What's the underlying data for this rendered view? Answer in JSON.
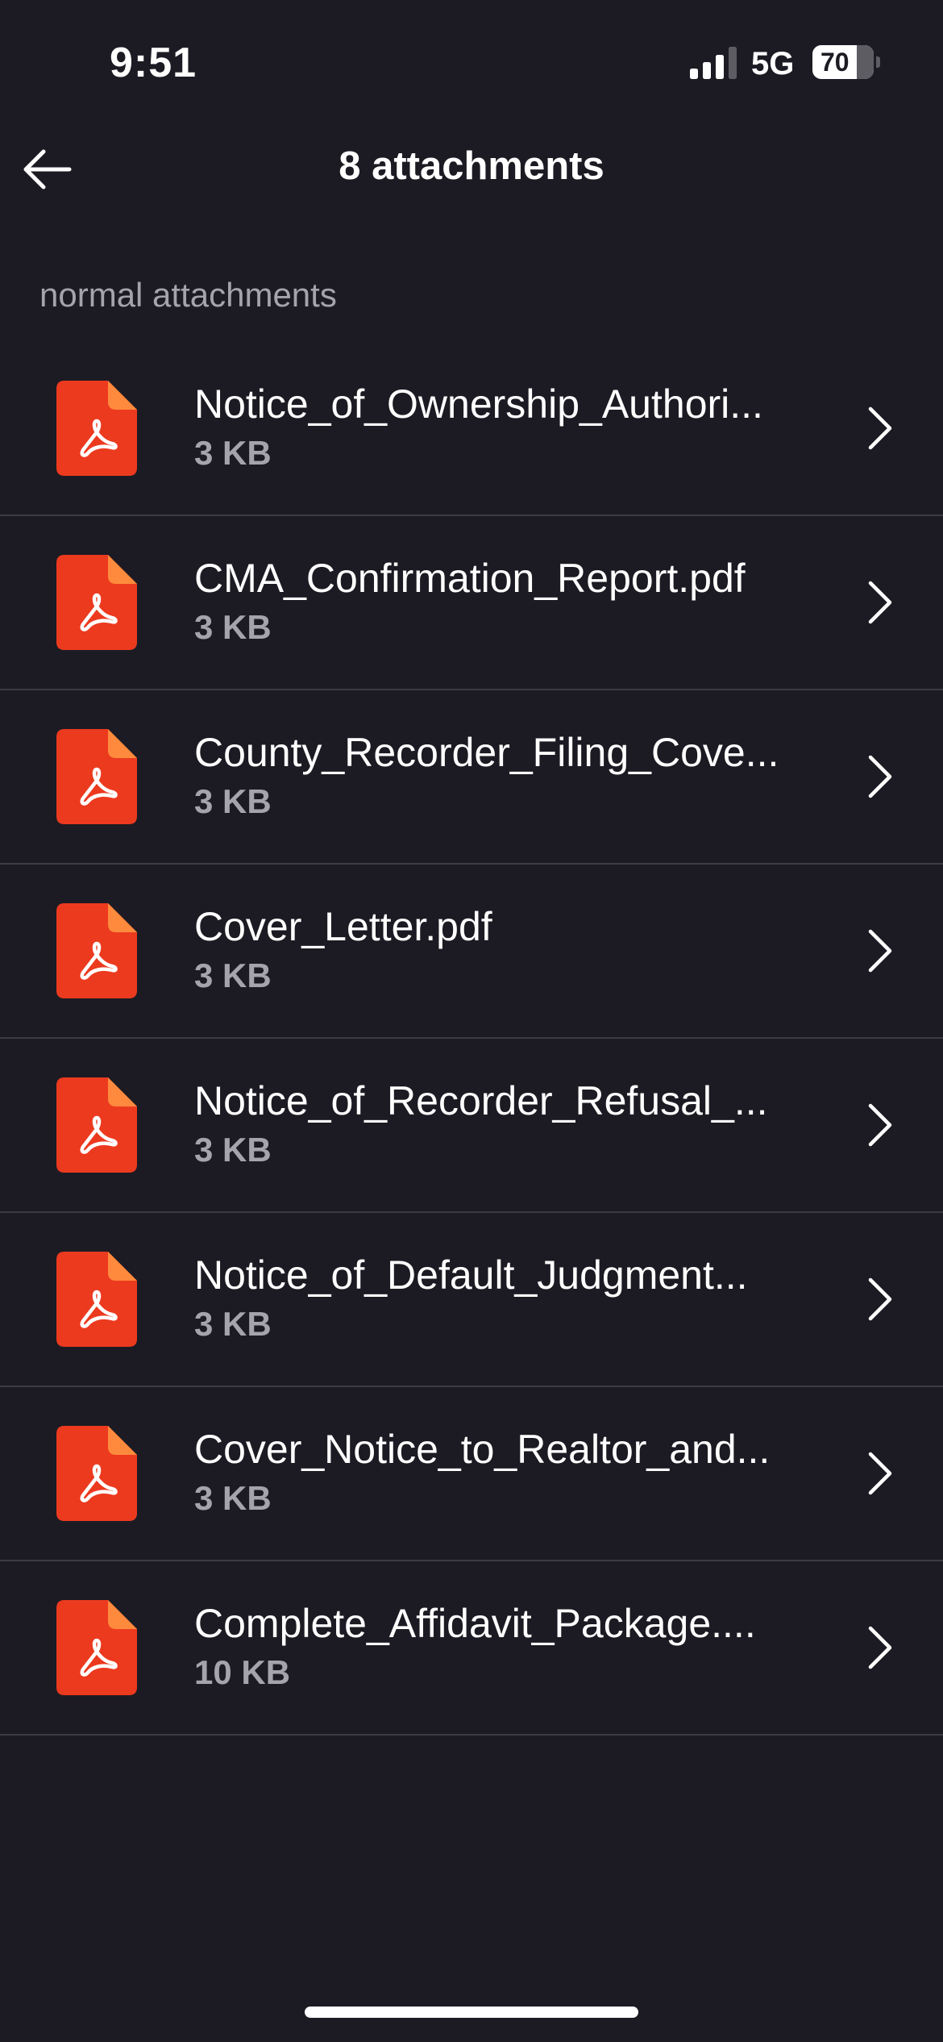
{
  "status_bar": {
    "time": "9:51",
    "network": "5G",
    "battery": "70"
  },
  "header": {
    "title": "8 attachments"
  },
  "section": {
    "label": "normal attachments"
  },
  "attachments": [
    {
      "name": "Notice_of_Ownership_Authori...",
      "size": "3 KB",
      "icon": "pdf-icon"
    },
    {
      "name": "CMA_Confirmation_Report.pdf",
      "size": "3 KB",
      "icon": "pdf-icon"
    },
    {
      "name": "County_Recorder_Filing_Cove...",
      "size": "3 KB",
      "icon": "pdf-icon"
    },
    {
      "name": "Cover_Letter.pdf",
      "size": "3 KB",
      "icon": "pdf-icon"
    },
    {
      "name": "Notice_of_Recorder_Refusal_...",
      "size": "3 KB",
      "icon": "pdf-icon"
    },
    {
      "name": "Notice_of_Default_Judgment...",
      "size": "3 KB",
      "icon": "pdf-icon"
    },
    {
      "name": "Cover_Notice_to_Realtor_and...",
      "size": "3 KB",
      "icon": "pdf-icon"
    },
    {
      "name": "Complete_Affidavit_Package....",
      "size": "10 KB",
      "icon": "pdf-icon"
    }
  ],
  "colors": {
    "background": "#1c1b23",
    "pdf_red": "#ec3a1f",
    "pdf_fold": "#ff8a3d",
    "secondary_text": "#a5a4ad",
    "divider": "#3c3b43"
  }
}
